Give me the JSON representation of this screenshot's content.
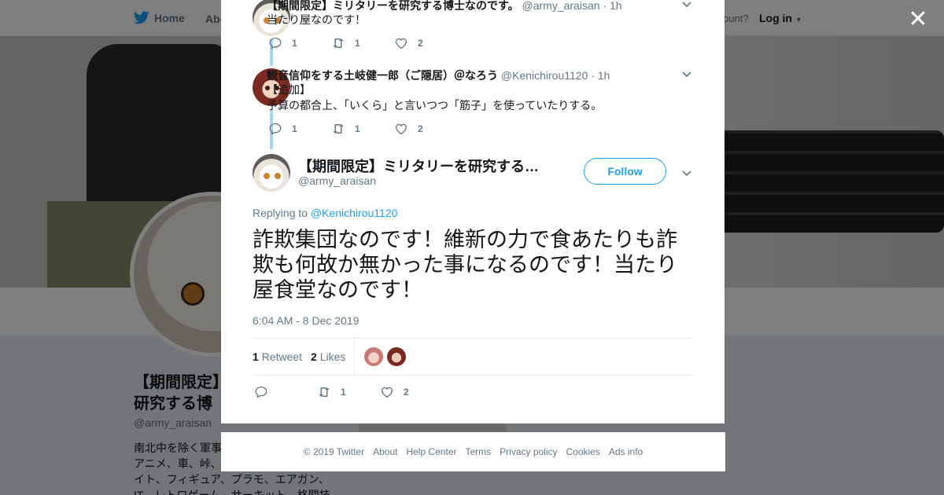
{
  "background": {
    "nav": {
      "home": "Home",
      "about": "Abo",
      "account_prompt": "ccount?",
      "login": "Log in"
    },
    "profile": {
      "name_line1": "【期間限定】",
      "name_line2": "研究する博",
      "handle": "@army_araisan",
      "bio_lines": [
        "南北中を除く軍事",
        "アニメ、車、峠、",
        "イト、フィギュア、プラモ、エアガン、",
        "IT、レトロゲーム、サーキット、格闘技"
      ],
      "pill_text": "Ads info"
    }
  },
  "modal": {
    "replies": [
      {
        "name": "【期間限定】ミリタリーを研究する博士なのです。",
        "handle": "@army_araisan",
        "time": "· 1h",
        "text_lines": [
          "当たり屋なのです！"
        ],
        "reply_count": "1",
        "retweet_count": "1",
        "like_count": "2"
      },
      {
        "name": "観音信仰をする土岐健一郎（ご隠居）＠なろう",
        "handle": "@Kenichirou1120",
        "time": "· 1h",
        "text_lines": [
          "【追加】",
          "予算の都合上、「いくら」と言いつつ「筋子」を使っていたりする。"
        ],
        "reply_count": "1",
        "retweet_count": "1",
        "like_count": "2"
      }
    ],
    "main_tweet": {
      "name": "【期間限定】ミリタリーを研究する…",
      "handle": "@army_araisan",
      "follow_label": "Follow",
      "replying_prefix": "Replying to",
      "replying_to": "@Kenichirou1120",
      "text": "詐欺集団なのです！維新の力で食あたりも詐欺も何故か無かった事になるのです！当たり屋食堂なのです！",
      "timestamp": "6:04 AM - 8 Dec 2019",
      "retweets_count": "1",
      "retweets_label": "Retweet",
      "likes_count": "2",
      "likes_label": "Likes",
      "action_retweet_count": "1",
      "action_like_count": "2"
    }
  },
  "footer": {
    "copyright": "© 2019 Twitter",
    "links": [
      "About",
      "Help Center",
      "Terms",
      "Privacy policy",
      "Cookies",
      "Ads info"
    ]
  },
  "colors": {
    "accent": "#1da1f2",
    "thread_line": "#a6d4f2",
    "muted_text": "#657786"
  },
  "icons": [
    "twitter-bird-icon",
    "close-icon",
    "reply-icon",
    "retweet-icon",
    "heart-icon",
    "chevron-down-icon"
  ]
}
